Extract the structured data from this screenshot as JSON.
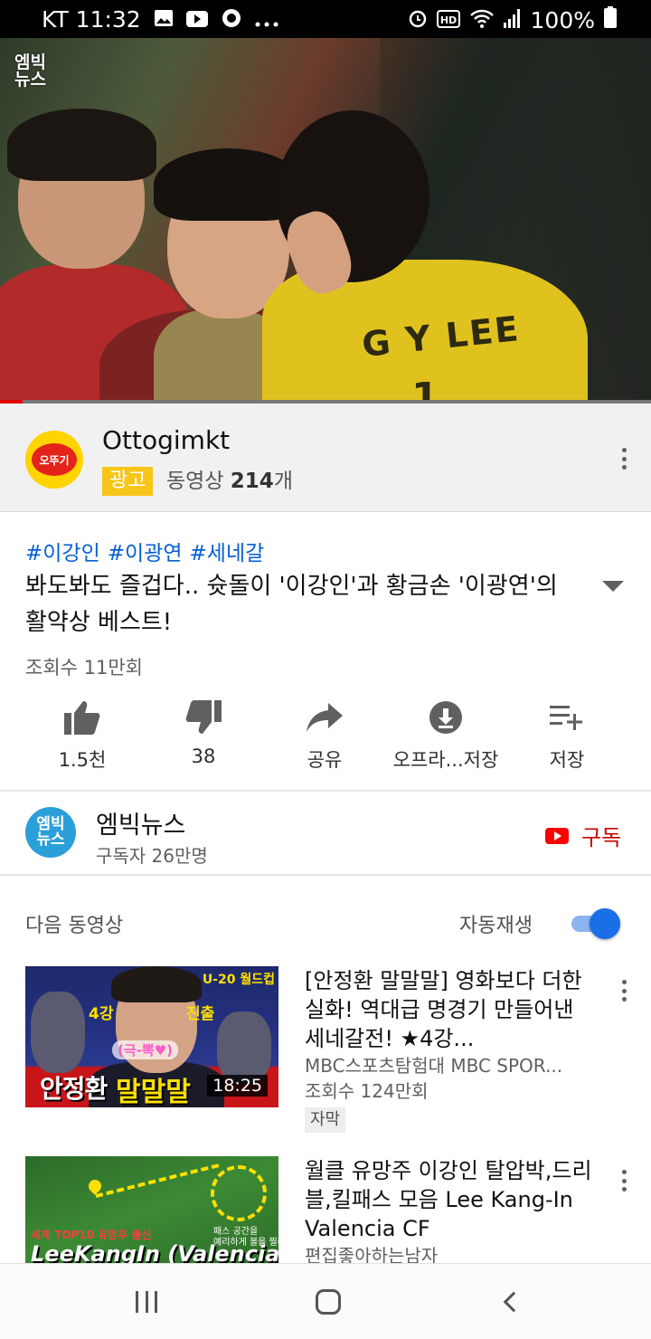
{
  "status_bar": {
    "carrier_time": "KT 11:32",
    "battery": "100%",
    "left_icons": [
      "image-icon",
      "youtube-icon",
      "notification-icon",
      "more-icon"
    ],
    "right_icons": [
      "alarm-icon",
      "hd-icon",
      "wifi-icon",
      "signal-icon",
      "battery-icon"
    ]
  },
  "video": {
    "watermark": "엠빅\n뉴스",
    "jersey_name": "G Y LEE",
    "jersey_number": "1",
    "progress": 0.035,
    "progress_color": "#e00000"
  },
  "ad": {
    "channel": "Ottogimkt",
    "logo_text": "오뚜기",
    "badge": "광고",
    "video_count_prefix": "동영상 ",
    "video_count": "214",
    "video_count_suffix": "개",
    "badge_color": "#f6c518"
  },
  "video_info": {
    "hashtags": [
      "#이강인",
      "#이광연",
      "#세네갈"
    ],
    "title": "봐도봐도 즐겁다.. 슛돌이 '이강인'과 황금손 '이광연'의 활약상 베스트!",
    "views": "조회수 11만회"
  },
  "actions": [
    {
      "icon": "thumbs-up-icon",
      "label": "1.5천"
    },
    {
      "icon": "thumbs-down-icon",
      "label": "38"
    },
    {
      "icon": "share-icon",
      "label": "공유"
    },
    {
      "icon": "download-icon",
      "label": "오프라...저장"
    },
    {
      "icon": "playlist-add-icon",
      "label": "저장"
    }
  ],
  "channel": {
    "avatar_text": "엠빅\n뉴스",
    "name": "엠빅뉴스",
    "subscribers": "구독자 26만명",
    "subscribe_label": "구독",
    "accent": "#cc0000"
  },
  "up_next": {
    "label": "다음 동영상",
    "autoplay_label": "자동재생",
    "autoplay_on": true,
    "toggle_color": "#1a6fe6"
  },
  "recommendations": [
    {
      "title": "[안정환 말말말] 영화보다 더한 실화! 역대급 명경기 만들어낸 세네갈전! ★4강...",
      "channel": "MBC스포츠탐험대 MBC SPOR...",
      "views": "조회수 124만회",
      "badge": "자막",
      "duration": "18:25",
      "thumb_text": {
        "tag": "U-20 월드컵",
        "left": "4강",
        "right": "진출",
        "pink": "(극-뽁♥)",
        "big_white": "안정환",
        "big_yellow": "말말말"
      }
    },
    {
      "title": "월클 유망주 이강인 탈압박,드리블,킬패스 모음 Lee Kang-In Valencia CF",
      "channel": "편집좋아하는남자",
      "thumb_text": {
        "red": "세계 TOP10 유망주 출신",
        "big": "LeeKangIn (Valencia)",
        "small": "패스 공간을\n예리하게 볼을 찔러"
      }
    }
  ],
  "nav": [
    "recents-icon",
    "home-icon",
    "back-icon"
  ]
}
